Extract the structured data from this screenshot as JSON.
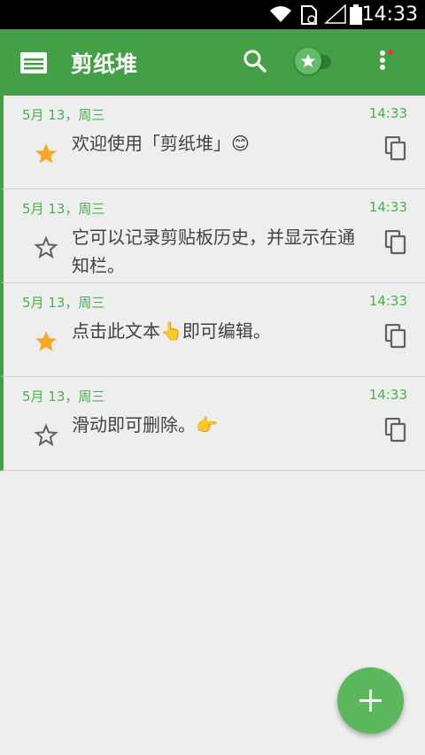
{
  "status_bar": {
    "time": "14:33",
    "icons": [
      "wifi-icon",
      "sim-icon",
      "signal-icon",
      "battery-icon"
    ]
  },
  "app_bar": {
    "title": "剪纸堆",
    "icons": [
      "clipboard-logo-icon",
      "search-icon",
      "star-toggle-icon",
      "more-vert-icon"
    ],
    "colors": {
      "primary": "#43a047",
      "accent": "#5cb85c",
      "notification_dot": "#e53935"
    }
  },
  "items": [
    {
      "date": "5月 13，周三",
      "time": "14:33",
      "text": "欢迎使用「剪纸堆」😊",
      "starred": true
    },
    {
      "date": "5月 13，周三",
      "time": "14:33",
      "text": "它可以记录剪贴板历史，并显示在通知栏。",
      "starred": false
    },
    {
      "date": "5月 13，周三",
      "time": "14:33",
      "text": "点击此文本👆即可编辑。",
      "starred": true
    },
    {
      "date": "5月 13，周三",
      "time": "14:33",
      "text": "滑动即可删除。👉",
      "starred": false
    }
  ],
  "fab": {
    "icon": "plus-icon"
  }
}
